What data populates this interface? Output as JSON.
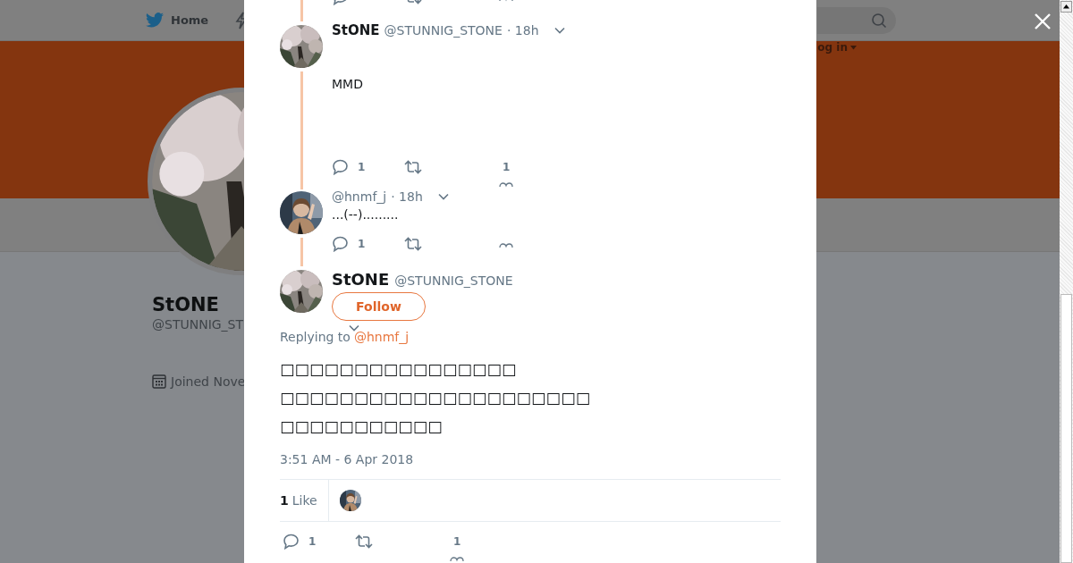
{
  "top_nav": {
    "home": "Home",
    "login": "og in"
  },
  "profile": {
    "name": "StONE",
    "handle": "@STUNNIG_ST",
    "joined": "Joined Nove"
  },
  "thread": [
    {
      "kind": "blossom",
      "name": "StONE",
      "handle": "@STUNNIG_STONE",
      "time": "· 18h",
      "text": "MMD",
      "reply_count": "1",
      "like_count": "1"
    },
    {
      "kind": "person",
      "handle": "@hnmf_j",
      "time": "· 18h",
      "text": "...(--).........",
      "reply_count": "1"
    }
  ],
  "main_tweet": {
    "name": "StONE",
    "handle": "@STUNNIG_STONE",
    "follow": "Follow",
    "replying_prefix": "Replying to",
    "replying_handle": "@hnmf_j",
    "text_lines": [
      "□□□□□□□□□□□□□□□□",
      "□□□□□□□□□□□□□□□□□□□□□",
      "□□□□□□□□□□□"
    ],
    "timestamp": "3:51 AM - 6 Apr 2018",
    "likes_count": "1",
    "likes_label": "Like",
    "reply_count": "1",
    "like_count": "1"
  }
}
